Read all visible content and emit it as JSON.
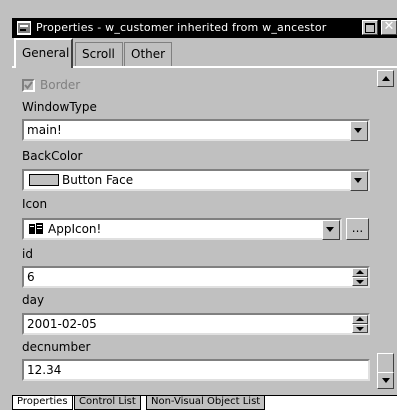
{
  "window": {
    "title": "Properties - w_customer inherited from w_ancestor",
    "icon": "properties-icon",
    "max_icon": "maximize-icon",
    "close_icon": "close-icon",
    "close_glyph": "✕"
  },
  "tabs": [
    {
      "label": "General",
      "selected": true
    },
    {
      "label": "Scroll",
      "selected": false
    },
    {
      "label": "Other",
      "selected": false
    }
  ],
  "properties": {
    "border": {
      "label": "Border",
      "checked": true,
      "disabled": true
    },
    "windowtype": {
      "label": "WindowType",
      "value": "main!"
    },
    "backcolor": {
      "label": "BackColor",
      "value": "Button Face",
      "swatch": "#c0c0c0"
    },
    "icon": {
      "label": "Icon",
      "value": "AppIcon!",
      "browse": "...",
      "icon": "app-icon"
    },
    "id": {
      "label": "id",
      "value": "6"
    },
    "day": {
      "label": "day",
      "value": "2001-02-05"
    },
    "decnumber": {
      "label": "decnumber",
      "value": "12.34"
    }
  },
  "bottom_tabs": [
    {
      "label": "Properties",
      "selected": true
    },
    {
      "label": "Control List",
      "selected": false
    },
    {
      "label": "Non-Visual Object List",
      "selected": false
    }
  ],
  "colors": {
    "face": "#c0c0c0",
    "titlebar": "#000000",
    "field": "#ffffff",
    "disabled_text": "#808080"
  }
}
